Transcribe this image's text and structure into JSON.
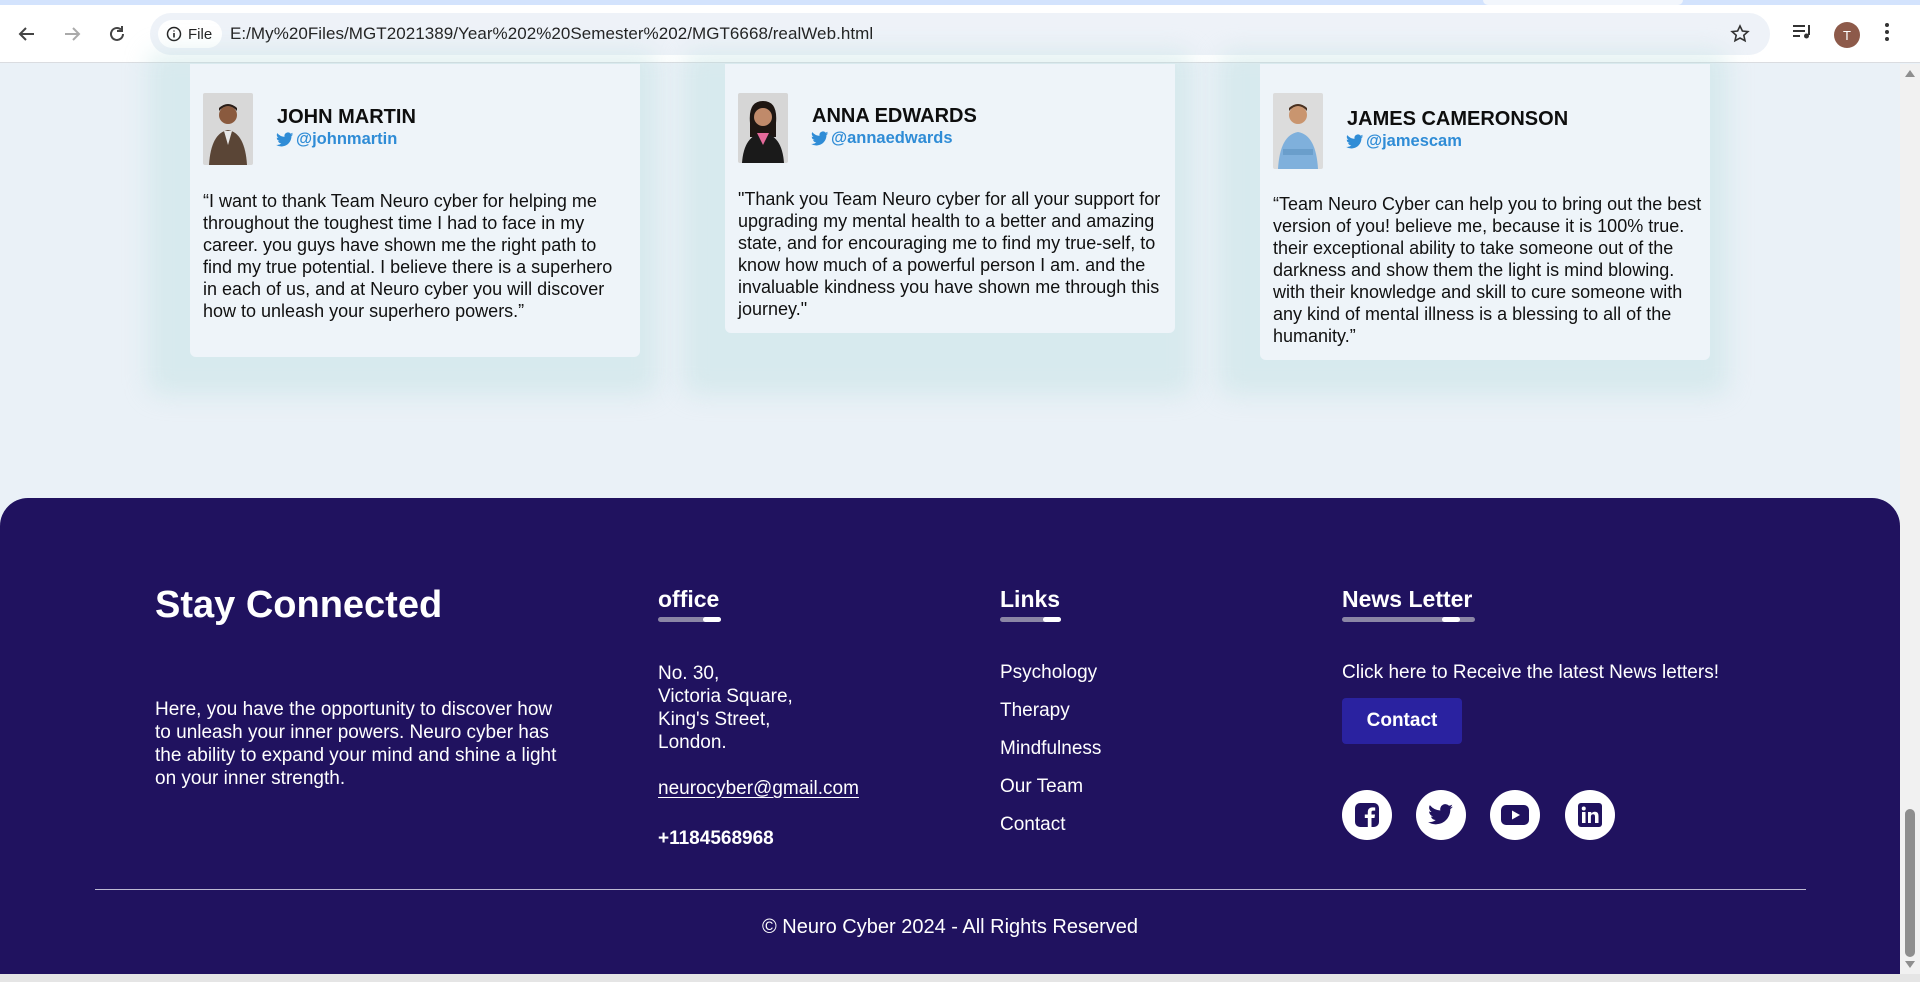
{
  "browser": {
    "chip_label": "File",
    "url": "E:/My%20Files/MGT2021389/Year%202%20Semester%202/MGT6668/realWeb.html",
    "avatar_letter": "T"
  },
  "testimonials": [
    {
      "name": "JOHN MARTIN",
      "handle": "@johnmartin",
      "quote": "“I want to thank Team Neuro cyber for helping me throughout the toughest time I had to face in my career. you guys have shown me the right path to find my true potential. I believe there is a superhero in each of us, and at Neuro cyber you will discover how to unleash your superhero powers.”"
    },
    {
      "name": "ANNA EDWARDS",
      "handle": "@annaedwards",
      "quote": "\"Thank you Team Neuro cyber for all your support for upgrading my mental health to a better and amazing state, and for encouraging me to find my true-self, to know how much of a powerful person I am. and the invaluable kindness you have shown me through this journey.\""
    },
    {
      "name": "JAMES CAMERONSON",
      "handle": "@jamescam",
      "quote": "“Team Neuro Cyber can help you to bring out the best version of you! believe me, because it is 100% true. their exceptional ability to take someone out of the darkness and show them the light is mind blowing. with their knowledge and skill to cure someone with any kind of mental illness is a blessing to all of the humanity.”"
    }
  ],
  "footer": {
    "title": "Stay Connected",
    "description": "Here, you have the opportunity to discover how to unleash your inner powers. Neuro cyber has the ability to expand your mind and shine a light on your inner strength.",
    "office": {
      "heading": "office",
      "address": [
        "No. 30,",
        "Victoria Square,",
        "King's Street,",
        "London."
      ],
      "email": "neurocyber@gmail.com",
      "phone": "+1184568968"
    },
    "links": {
      "heading": "Links",
      "items": [
        "Psychology",
        "Therapy",
        "Mindfulness",
        "Our Team",
        "Contact"
      ]
    },
    "newsletter": {
      "heading": "News Letter",
      "text": "Click here to Receive the latest News letters!",
      "button": "Contact"
    },
    "social_icons": [
      "facebook-icon",
      "twitter-icon",
      "youtube-icon",
      "linkedin-icon"
    ],
    "copyright": "© Neuro Cyber 2024 - All Rights Reserved"
  },
  "colors": {
    "footer_bg": "#20125f",
    "page_bg": "#eaf1f7",
    "twitter_blue": "#2f8cd6",
    "contact_button": "#2a22a0"
  }
}
